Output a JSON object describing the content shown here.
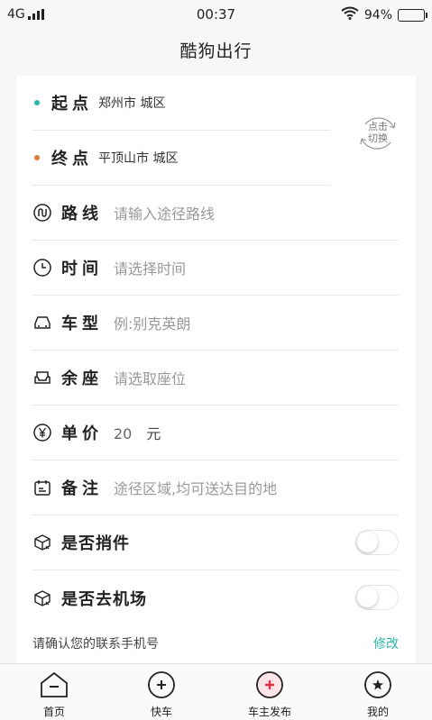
{
  "status_bar": {
    "network": "4G",
    "time": "00:37",
    "battery": "94%",
    "battery_level": 0.94
  },
  "nav": {
    "title": "酷狗出行"
  },
  "form": {
    "origin": {
      "label": "起点",
      "value": "郑州市 城区",
      "dot_color": "#2bb6a8"
    },
    "destination": {
      "label": "终点",
      "value": "平顶山市 城区",
      "dot_color": "#e07b39"
    },
    "switch_button": {
      "line1": "点击",
      "line2": "切换"
    },
    "route": {
      "label": "路线",
      "placeholder": "请输入途径路线"
    },
    "time": {
      "label": "时间",
      "placeholder": "请选择时间"
    },
    "car_model": {
      "label": "车型",
      "placeholder": "例:别克英朗"
    },
    "seats": {
      "label": "余座",
      "placeholder": "请选取座位"
    },
    "price": {
      "label": "单价",
      "value": "20",
      "unit": "元"
    },
    "note": {
      "label": "备注",
      "placeholder": "途径区域,均可送达目的地"
    },
    "carry_parcel": {
      "label": "是否捎件",
      "on": false
    },
    "to_airport": {
      "label": "是否去机场",
      "on": false
    }
  },
  "phone_confirm": {
    "text": "请确认您的联系手机号",
    "edit_label": "修改"
  },
  "tabs": [
    {
      "label": "首页"
    },
    {
      "label": "快车"
    },
    {
      "label": "车主发布",
      "accent": "#e0304a"
    },
    {
      "label": "我的"
    }
  ],
  "colors": {
    "accent": "#2bb6a8",
    "origin_dot": "#2bb6a8",
    "destination_dot": "#e07b39"
  }
}
